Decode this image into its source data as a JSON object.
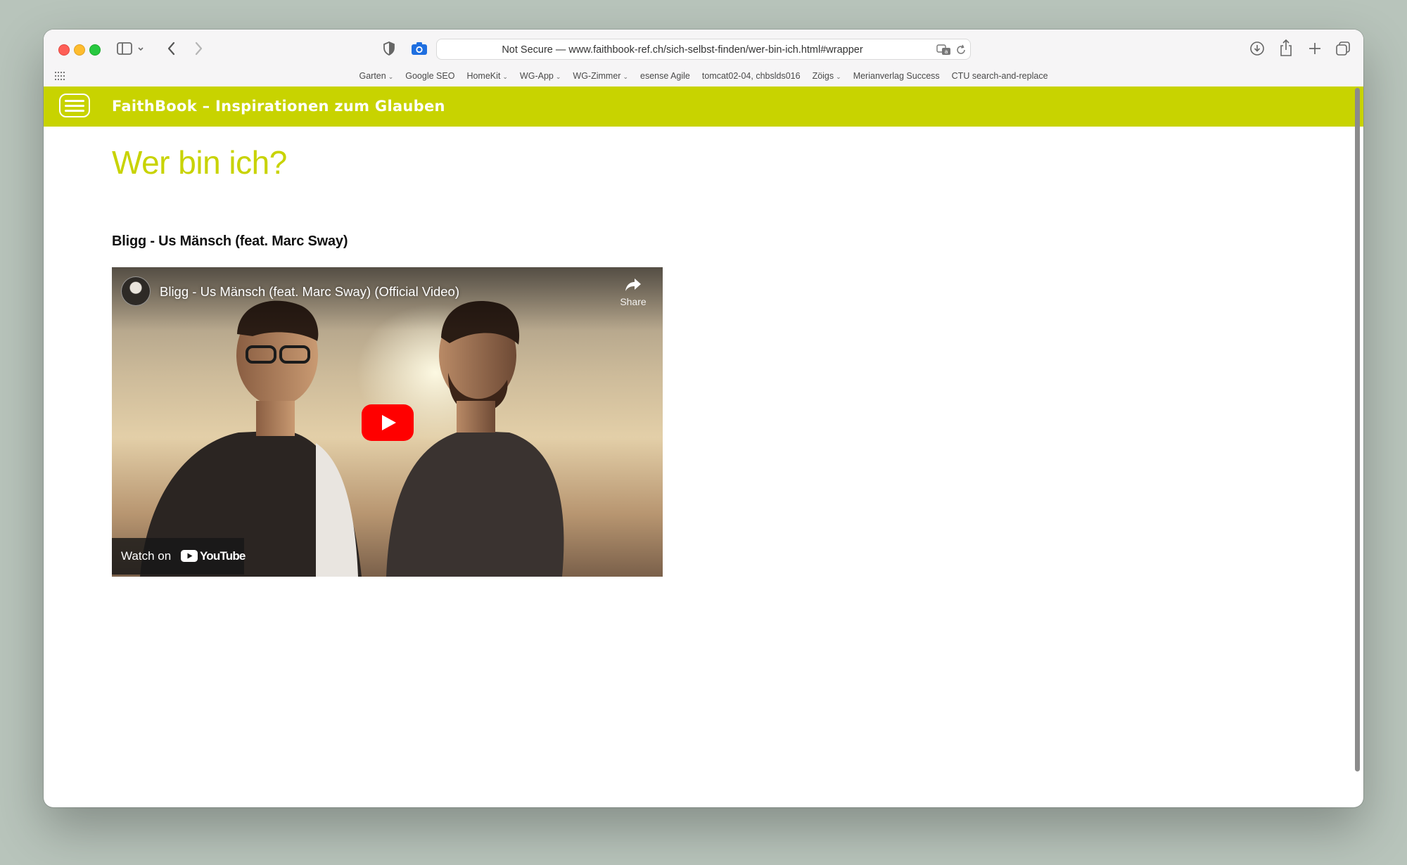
{
  "browser": {
    "address": "Not Secure — www.faithbook-ref.ch/sich-selbst-finden/wer-bin-ich.html#wrapper",
    "bookmarks": [
      {
        "label": "Garten",
        "has_menu": true
      },
      {
        "label": "Google SEO",
        "has_menu": false
      },
      {
        "label": "HomeKit",
        "has_menu": true
      },
      {
        "label": "WG-App",
        "has_menu": true
      },
      {
        "label": "WG-Zimmer",
        "has_menu": true
      },
      {
        "label": "esense Agile",
        "has_menu": false
      },
      {
        "label": "tomcat02-04, chbslds016",
        "has_menu": false
      },
      {
        "label": "Zöigs",
        "has_menu": true
      },
      {
        "label": "Merianverlag Success",
        "has_menu": false
      },
      {
        "label": "CTU search-and-replace",
        "has_menu": false
      }
    ],
    "icons": [
      "sidebar-icon",
      "back-icon",
      "forward-icon",
      "shield-icon",
      "camera-icon",
      "translate-icon",
      "reload-icon",
      "download-icon",
      "share-icon",
      "new-tab-icon",
      "tabs-overview-icon",
      "apps-grid-icon"
    ]
  },
  "site": {
    "title": "FaithBook – Inspirationen zum Glauben",
    "accent_color": "#c8d300"
  },
  "page": {
    "heading": "Wer bin ich?",
    "video_heading": "Bligg - Us Mänsch (feat. Marc Sway)"
  },
  "video": {
    "title": "Bligg - Us Mänsch (feat. Marc Sway) (Official Video)",
    "share_label": "Share",
    "watch_on": "Watch on",
    "platform": "YouTube"
  }
}
